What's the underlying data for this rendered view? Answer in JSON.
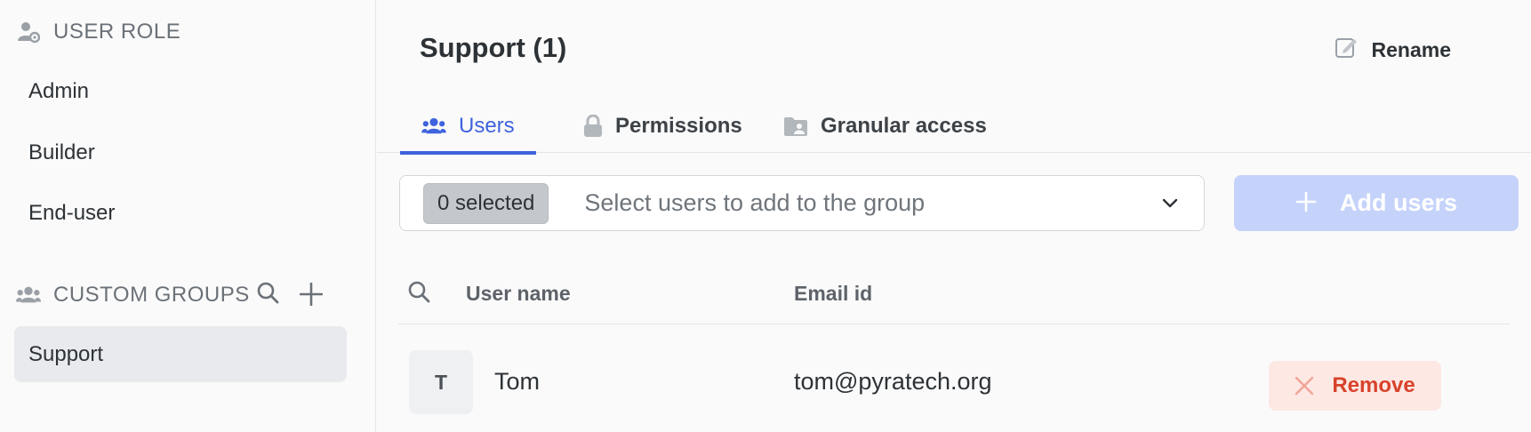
{
  "sidebar": {
    "user_role_header": "USER ROLE",
    "roles": [
      {
        "label": "Admin"
      },
      {
        "label": "Builder"
      },
      {
        "label": "End-user"
      }
    ],
    "custom_groups_header": "CUSTOM GROUPS",
    "groups": [
      {
        "label": "Support",
        "selected": true
      }
    ]
  },
  "main": {
    "title": "Support (1)",
    "rename_label": "Rename",
    "tabs": [
      {
        "label": "Users",
        "active": true,
        "icon": "users-icon"
      },
      {
        "label": "Permissions",
        "active": false,
        "icon": "lock-icon"
      },
      {
        "label": "Granular access",
        "active": false,
        "icon": "folder-user-icon"
      }
    ],
    "select": {
      "selected_count_label": "0 selected",
      "placeholder": "Select users to add to the group"
    },
    "add_users_label": "Add users",
    "table": {
      "columns": [
        "User name",
        "Email id"
      ],
      "rows": [
        {
          "initial": "T",
          "name": "Tom",
          "email": "tom@pyratech.org",
          "action": "Remove"
        }
      ]
    }
  },
  "colors": {
    "accent": "#3e63dd",
    "add_button_disabled": "#c5d3fb",
    "remove_bg": "#fde8e4",
    "remove_text": "#d8432b"
  }
}
